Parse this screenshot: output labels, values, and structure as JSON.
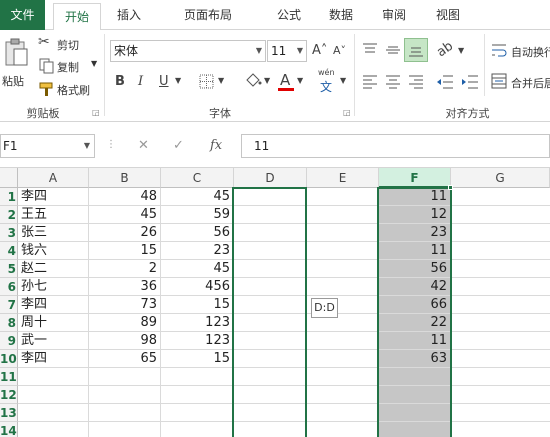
{
  "tabs": [
    {
      "label": "文件"
    },
    {
      "label": "开始"
    },
    {
      "label": "插入"
    },
    {
      "label": "页面布局"
    },
    {
      "label": "公式"
    },
    {
      "label": "数据"
    },
    {
      "label": "审阅"
    },
    {
      "label": "视图"
    }
  ],
  "ribbon": {
    "clipboard": {
      "paste": "粘贴",
      "cut": "剪切",
      "copy": "复制",
      "format_painter": "格式刷",
      "group_label": "剪贴板"
    },
    "font": {
      "font_name": "宋体",
      "font_size": "11",
      "grow_icon": "A˄",
      "shrink_icon": "A˅",
      "bold": "B",
      "italic": "I",
      "underline": "U",
      "font_color_letter": "A",
      "font_color_bar": "#e00000",
      "phonetic_top": "wén",
      "phonetic_bottom": "文",
      "group_label": "字体"
    },
    "alignment": {
      "wrap_text": "自动换行",
      "merge_center": "合并后居",
      "group_label": "对齐方式"
    }
  },
  "formula_bar": {
    "name_box": "F1",
    "cancel_icon": "✕",
    "enter_icon": "✓",
    "fx_label": "fx",
    "formula_value": "11"
  },
  "grid": {
    "column_headers": [
      "A",
      "B",
      "C",
      "D",
      "E",
      "F",
      "G"
    ],
    "selected_column": "F",
    "row_headers": [
      "1",
      "2",
      "3",
      "4",
      "5",
      "6",
      "7",
      "8",
      "9",
      "10",
      "11",
      "12",
      "13",
      "14"
    ],
    "rows": [
      {
        "a": "李四",
        "b": "48",
        "c": "45",
        "f": "11"
      },
      {
        "a": "王五",
        "b": "45",
        "c": "59",
        "f": "12"
      },
      {
        "a": "张三",
        "b": "26",
        "c": "56",
        "f": "23"
      },
      {
        "a": "钱六",
        "b": "15",
        "c": "23",
        "f": "11"
      },
      {
        "a": "赵二",
        "b": "2",
        "c": "45",
        "f": "56"
      },
      {
        "a": "孙七",
        "b": "36",
        "c": "456",
        "f": "42"
      },
      {
        "a": "李四",
        "b": "73",
        "c": "15",
        "f": "66"
      },
      {
        "a": "周十",
        "b": "89",
        "c": "123",
        "f": "22"
      },
      {
        "a": "武一",
        "b": "98",
        "c": "123",
        "f": "11"
      },
      {
        "a": "李四",
        "b": "65",
        "c": "15",
        "f": "63"
      }
    ],
    "drag_tooltip": "D:D"
  },
  "colors": {
    "accent": "#217346",
    "selection_fill": "#c6c6c6",
    "header_selected_fill": "#d3f0e0"
  }
}
